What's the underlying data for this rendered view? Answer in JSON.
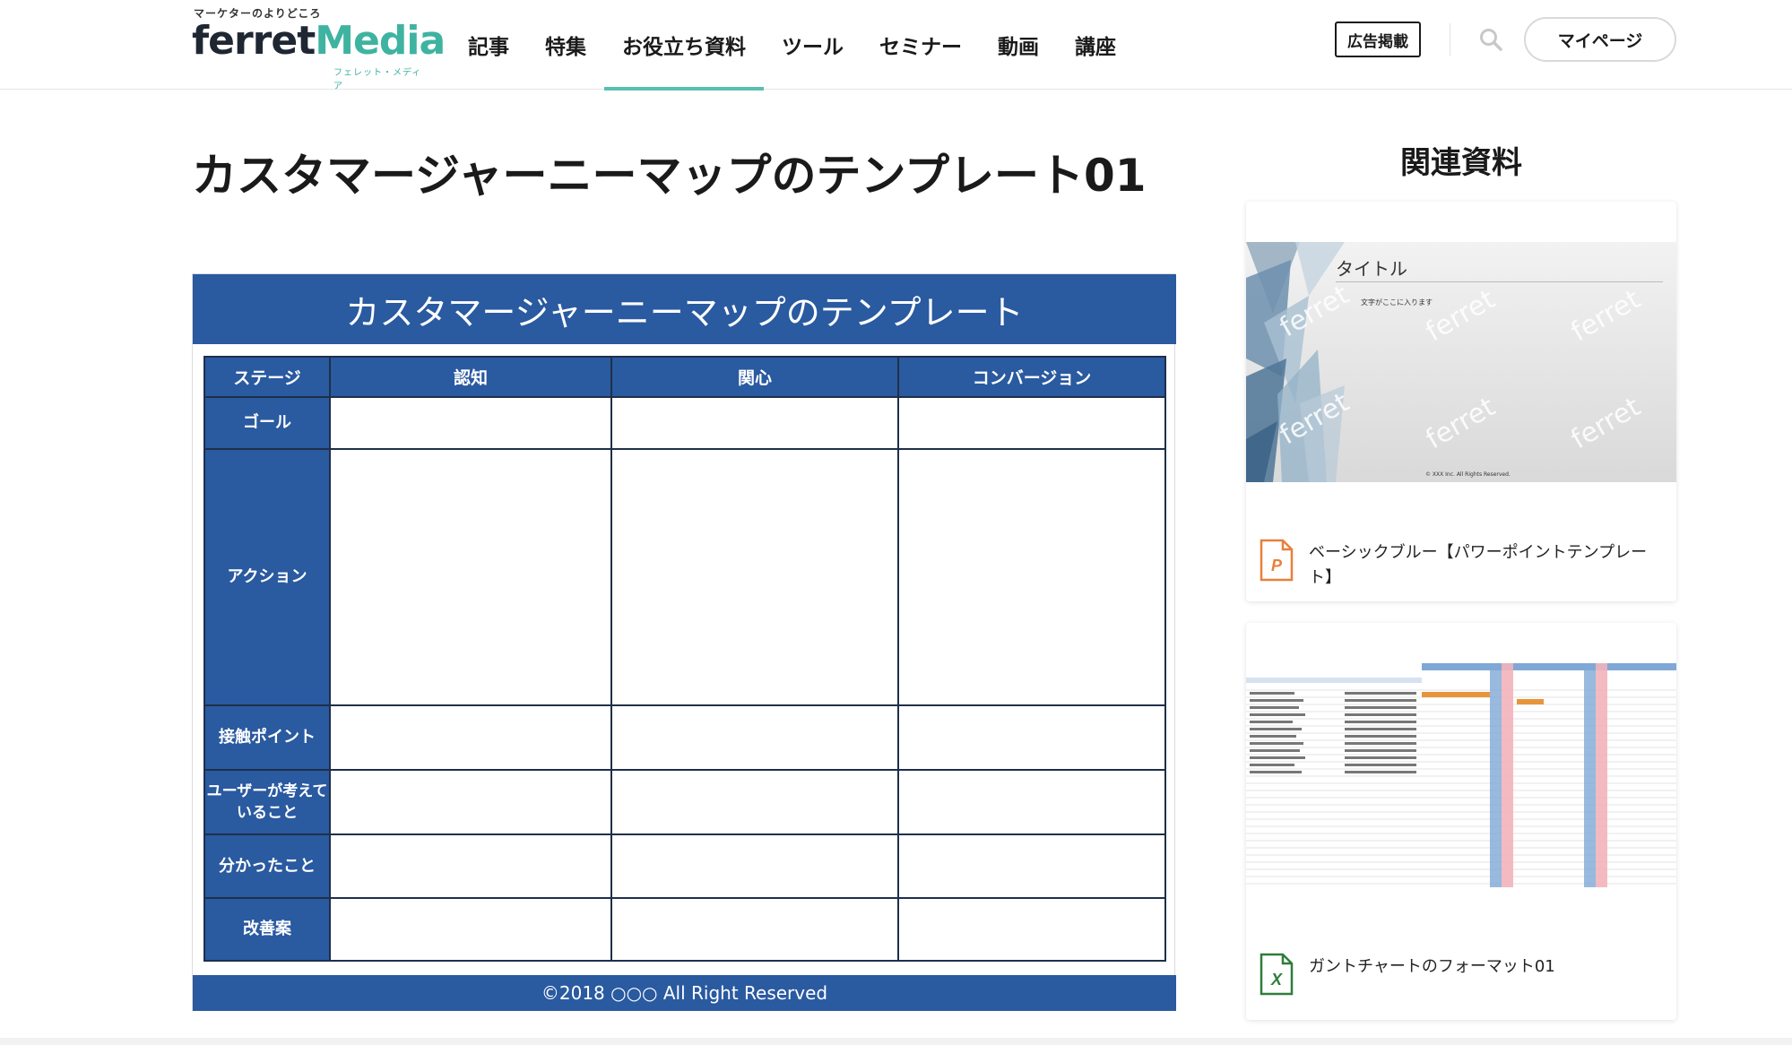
{
  "header": {
    "logo": {
      "tagline": "マーケターのよりどころ",
      "word_ferret": "ferret",
      "word_media": "Media",
      "sub": "フェレット・メディア"
    },
    "nav": [
      {
        "label": "記事",
        "active": false
      },
      {
        "label": "特集",
        "active": false
      },
      {
        "label": "お役立ち資料",
        "active": true
      },
      {
        "label": "ツール",
        "active": false
      },
      {
        "label": "セミナー",
        "active": false
      },
      {
        "label": "動画",
        "active": false
      },
      {
        "label": "講座",
        "active": false
      }
    ],
    "ad_button": "広告掲載",
    "search_icon": "search-icon",
    "mypage_button": "マイページ"
  },
  "main": {
    "title": "カスタマージャーニーマップのテンプレート01",
    "document": {
      "header": "カスタマージャーニーマップのテンプレート",
      "columns": [
        "ステージ",
        "認知",
        "関心",
        "コンバージョン"
      ],
      "rows": [
        {
          "label": "ゴール"
        },
        {
          "label": "アクション"
        },
        {
          "label": "接触ポイント"
        },
        {
          "label": "ユーザーが考えていること"
        },
        {
          "label": "分かったこと"
        },
        {
          "label": "改善案"
        }
      ],
      "footer": "©2018 ○○○ All Right Reserved"
    }
  },
  "sidebar": {
    "title": "関連資料",
    "cards": [
      {
        "thumb_title": "タイトル",
        "thumb_subtitle": "文字がここに入ります",
        "thumb_watermark": "ferret",
        "thumb_copyright": "© XXX Inc. All Rights Reserved.",
        "file_type": "P",
        "file_icon": "powerpoint-file-icon",
        "label": "ベーシックブルー【パワーポイントテンプレート】"
      },
      {
        "file_type": "X",
        "file_icon": "excel-file-icon",
        "label": "ガントチャートのフォーマット01"
      }
    ]
  },
  "colors": {
    "accent_teal": "#58bfb2",
    "doc_blue": "#2a5aa0",
    "ppt_orange": "#e8803a",
    "excel_green": "#2e7d3a"
  }
}
